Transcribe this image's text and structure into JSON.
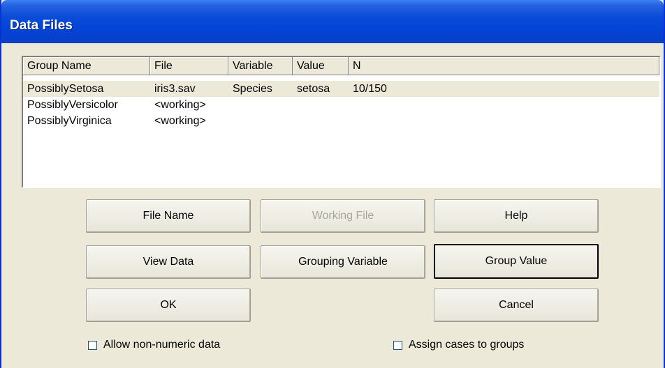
{
  "window": {
    "title": "Data Files"
  },
  "table": {
    "columns": [
      "Group Name",
      "File",
      "Variable",
      "Value",
      "N"
    ],
    "rows": [
      {
        "group": "PossiblySetosa",
        "file": "iris3.sav",
        "variable": "Species",
        "value": "setosa",
        "n": "10/150"
      },
      {
        "group": "PossiblyVersicolor",
        "file": "<working>",
        "variable": "",
        "value": "",
        "n": ""
      },
      {
        "group": "PossiblyVirginica",
        "file": "<working>",
        "variable": "",
        "value": "",
        "n": ""
      }
    ]
  },
  "buttons": {
    "file_name": "File Name",
    "working_file": "Working File",
    "help": "Help",
    "view_data": "View Data",
    "grouping_variable": "Grouping Variable",
    "group_value": "Group Value",
    "ok": "OK",
    "cancel": "Cancel"
  },
  "checkboxes": {
    "allow_non_numeric": {
      "label": "Allow non-numeric data",
      "checked": false
    },
    "assign_cases": {
      "label": "Assign cases to groups",
      "checked": false
    }
  }
}
